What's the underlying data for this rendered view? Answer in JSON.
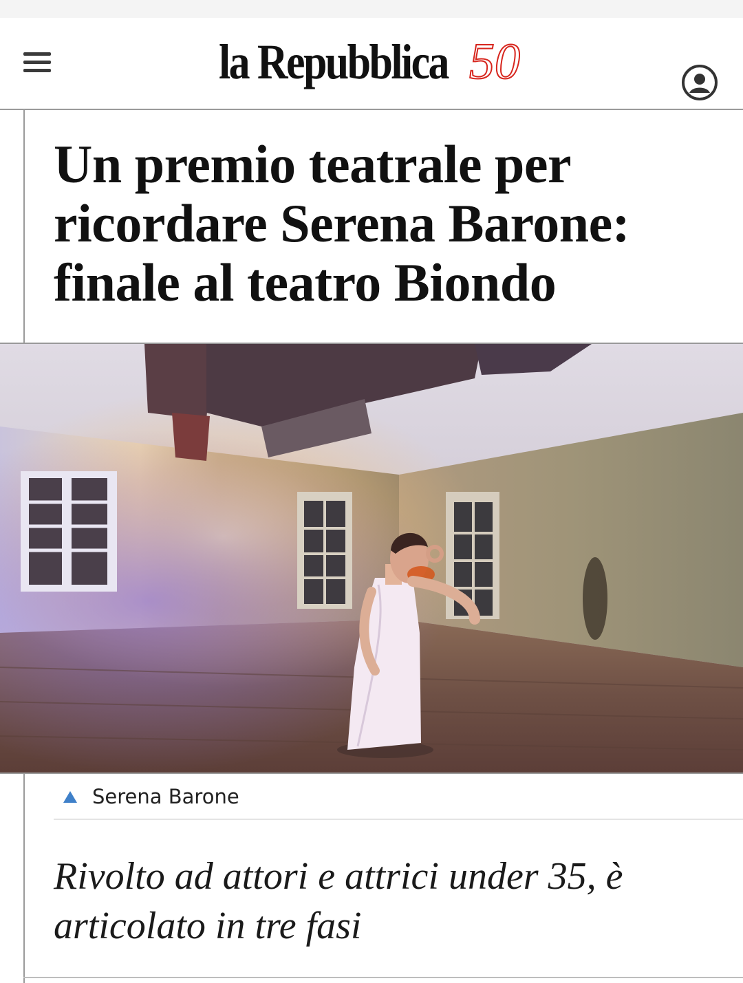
{
  "header": {
    "logo_text": "la Repubblica",
    "logo_anniversary": "50"
  },
  "article": {
    "title": "Un premio teatrale per ricordare Serena Barone: finale al teatro Biondo",
    "photo_caption": "Serena Barone",
    "summary": "Rivolto ad attori e attrici under 35, è articolato in tre fasi"
  },
  "colors": {
    "logo_red": "#d7261e",
    "caption_arrow": "#3f80c9"
  },
  "icons": {
    "menu": "hamburger-icon",
    "account": "user-circle-icon",
    "caption_toggle": "triangle-up-icon"
  }
}
